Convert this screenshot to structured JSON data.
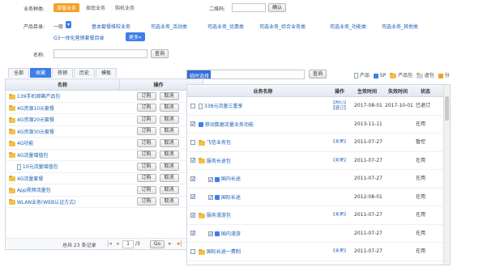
{
  "filter": {
    "biz_type_label": "业务种类:",
    "biz_types": [
      "增值业务",
      "家庭业务",
      "购机业务"
    ],
    "qr_label": "二维码:",
    "confirm": "确认"
  },
  "category": {
    "label": "产品目录:",
    "first_level": "一般",
    "items": [
      "基本套餐维较业务",
      "司选业务_活动类",
      "司选业务_优惠类",
      "司选业务_综合业务类",
      "司选业务_功能类",
      "司选业务_其他类"
    ],
    "item_row2": "G3一体化营销套餐目录",
    "more": "更多»"
  },
  "name_search": {
    "label": "名称:",
    "button": "查询"
  },
  "left": {
    "tabs": [
      "全部",
      "收藏",
      "热销",
      "历史",
      "模板"
    ],
    "col_name": "名称",
    "col_op": "操作",
    "order": "订购",
    "cancel": "取消",
    "rows": [
      "139手机邮箱产品包",
      "4G资源10元套餐",
      "4G资源20元套餐",
      "4G资源30元套餐",
      "4G功能",
      "4G流量增值包",
      "10元流量增值包",
      "4G流量套餐",
      "App视频流量包",
      "WLAN业务(WEB认证方式)"
    ],
    "pager_total": "总共 23 条记录",
    "pager_page": "1",
    "pager_of": "/3",
    "pager_go": "Go"
  },
  "right": {
    "search_text": "临时选择",
    "search_btn": "查询",
    "legend": [
      "产品",
      "SP",
      "产品包",
      "虚包",
      "分"
    ],
    "col_name": "业务名称",
    "col_op": "操作",
    "col_eff": "生效时间",
    "col_exp": "失效时间",
    "col_status": "状态",
    "rows": [
      {
        "name": "338元流量三重享",
        "op": "【网订】【退订】",
        "eff": "2017-08-01",
        "exp": "2017-10-01",
        "status": "已退订"
      },
      {
        "name": "移动数据流量业务功能",
        "op": "",
        "eff": "2013-11-11",
        "exp": "",
        "status": "在用"
      },
      {
        "name": "飞信业务包",
        "op": "【变更】",
        "eff": "2011-07-27",
        "exp": "",
        "status": "暂控"
      },
      {
        "name": "服务长途包",
        "op": "【变更】",
        "eff": "2011-07-27",
        "exp": "",
        "status": "在用"
      },
      {
        "name": "国内长途",
        "op": "",
        "eff": "2011-07-27",
        "exp": "",
        "status": "在用"
      },
      {
        "name": "国际长途",
        "op": "",
        "eff": "2012-08-01",
        "exp": "",
        "status": "在用"
      },
      {
        "name": "服务漫游包",
        "op": "【变更】",
        "eff": "2011-07-27",
        "exp": "",
        "status": "在用"
      },
      {
        "name": "国内漫游",
        "op": "",
        "eff": "2011-07-27",
        "exp": "",
        "status": "在用"
      },
      {
        "name": "国际长途一费制",
        "op": "【变更】",
        "eff": "2011-07-27",
        "exp": "",
        "status": "在用"
      }
    ]
  },
  "colors": {
    "accent": "#3f7ee8",
    "orange": "#f4a02a",
    "link": "#1a5fb4"
  }
}
